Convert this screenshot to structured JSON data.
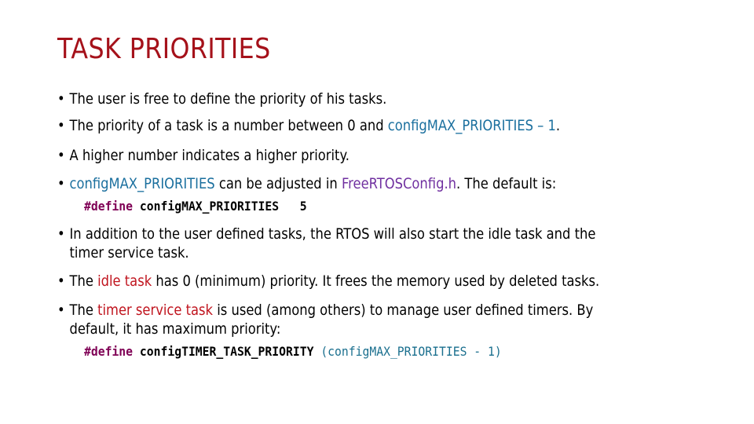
{
  "slide": {
    "title": "TASK PRIORITIES",
    "bullet_char": "•",
    "bullets_top": [
      {
        "text": "The user is free to define the priority of his tasks."
      },
      {
        "pre": "The priority of a task is a number between 0 and ",
        "highlight": "configMAX_PRIORITIES – 1",
        "post": "."
      },
      {
        "text": "A higher number indicates a higher priority."
      },
      {
        "highlight1": "configMAX_PRIORITIES",
        "mid": " can be adjusted in ",
        "highlight2": "FreeRTOSConfig.h",
        "post": ". The default is:"
      }
    ],
    "code1": {
      "keyword": "#define",
      "name": " configMAX_PRIORITIES",
      "value": "   5"
    },
    "bullets_bottom": [
      {
        "line1": "In addition to the user defined tasks, the RTOS will also start the idle task and the",
        "line2": "timer service task."
      },
      {
        "pre": "The ",
        "highlight": "idle task",
        "post": " has 0 (minimum) priority. It frees the memory used by deleted tasks."
      },
      {
        "pre": "The ",
        "highlight": "timer service task",
        "post": " is used (among others) to manage user defined timers. By",
        "line2": "default, it has maximum priority:"
      }
    ],
    "code2": {
      "keyword": "#define",
      "name": " configTIMER_TASK_PRIORITY",
      "value": " (configMAX_PRIORITIES - 1)"
    }
  }
}
